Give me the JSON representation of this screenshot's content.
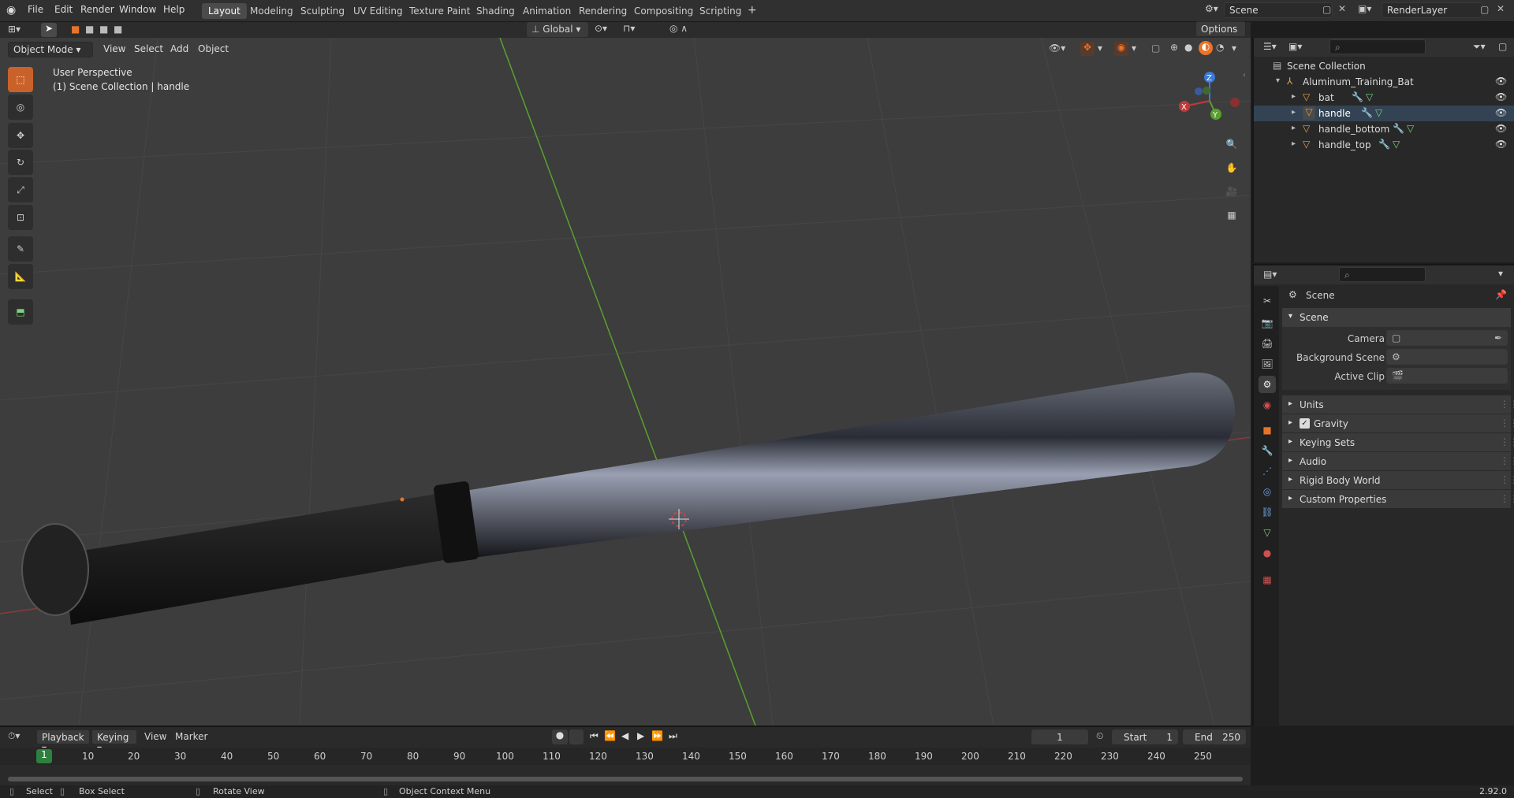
{
  "topbar": {
    "menus": [
      "File",
      "Edit",
      "Render",
      "Window",
      "Help"
    ],
    "workspaces": [
      "Layout",
      "Modeling",
      "Sculpting",
      "UV Editing",
      "Texture Paint",
      "Shading",
      "Animation",
      "Rendering",
      "Compositing",
      "Scripting"
    ],
    "active_workspace": "Layout",
    "add_tab": "+",
    "scene": "Scene",
    "view_layer": "RenderLayer"
  },
  "viewport_header": {
    "mode": "Object Mode",
    "menus": [
      "View",
      "Select",
      "Add",
      "Object"
    ],
    "orientation": "Global",
    "options": "Options"
  },
  "viewport": {
    "perspective": "User Perspective",
    "collection_info": "(1) Scene Collection | handle",
    "gizmo": {
      "x": "X",
      "y": "Y",
      "z": "Z"
    }
  },
  "outliner": {
    "root": "Scene Collection",
    "collection": "Aluminum_Training_Bat",
    "objects": [
      "bat",
      "handle",
      "handle_bottom",
      "handle_top"
    ]
  },
  "properties": {
    "context": "Scene",
    "panel": "Scene",
    "fields": [
      {
        "label": "Camera",
        "value": ""
      },
      {
        "label": "Background Scene",
        "value": ""
      },
      {
        "label": "Active Clip",
        "value": ""
      }
    ],
    "subpanels": [
      "Units",
      "Gravity",
      "Keying Sets",
      "Audio",
      "Rigid Body World",
      "Custom Properties"
    ],
    "gravity_checked": true
  },
  "timeline": {
    "menus": [
      "Playback",
      "Keying",
      "View",
      "Marker"
    ],
    "current_frame": "1",
    "start_label": "Start",
    "start": "1",
    "end_label": "End",
    "end": "250",
    "ticks": [
      "1",
      "10",
      "20",
      "30",
      "40",
      "50",
      "60",
      "70",
      "80",
      "90",
      "100",
      "110",
      "120",
      "130",
      "140",
      "150",
      "160",
      "170",
      "180",
      "190",
      "200",
      "210",
      "220",
      "230",
      "240",
      "250"
    ]
  },
  "statusbar": {
    "select": "Select",
    "box_select": "Box Select",
    "rotate": "Rotate View",
    "context_menu": "Object Context Menu",
    "version": "2.92.0"
  },
  "colors": {
    "accent": "#e8742a",
    "x_axis": "#c03a3a",
    "y_axis": "#5aa02f",
    "z_axis": "#3a7ad8",
    "object_icon": "#e5a04e"
  }
}
